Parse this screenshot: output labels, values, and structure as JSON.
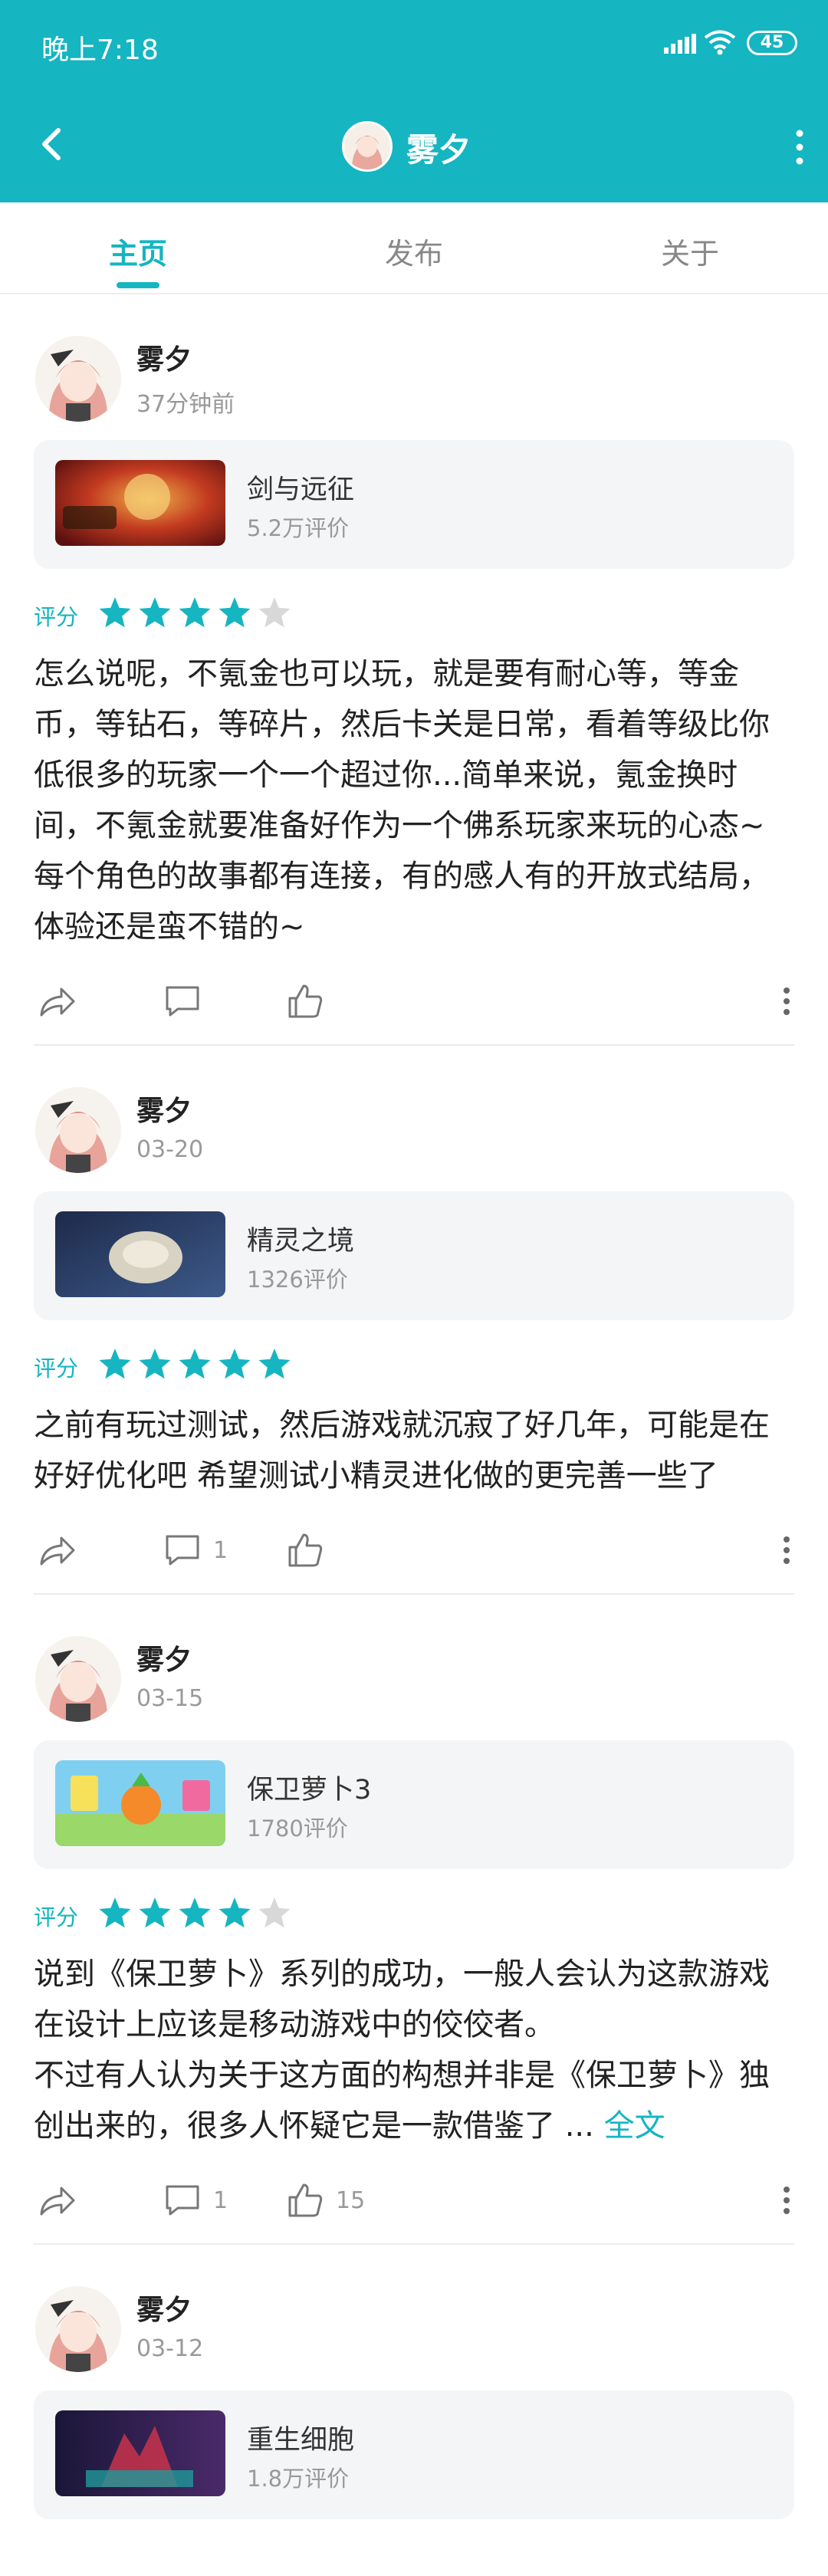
{
  "status_bar": {
    "time": "晚上7:18",
    "battery": "45"
  },
  "nav": {
    "title": "雾夕"
  },
  "tabs": [
    {
      "label": "主页"
    },
    {
      "label": "发布"
    },
    {
      "label": "关于"
    }
  ],
  "colors": {
    "accent": "#15b5c1",
    "star_off": "#d8d8d8"
  },
  "posts": [
    {
      "user": "雾夕",
      "time": "37分钟前",
      "game": {
        "name": "剑与远征",
        "reviews": "5.2万评价"
      },
      "rating_label": "评分",
      "stars": 4,
      "content": "怎么说呢，不氪金也可以玩，就是要有耐心等，等金币，等钻石，等碎片，然后卡关是日常，看着等级比你低很多的玩家一个一个超过你...简单来说，氪金换时间，不氪金就要准备好作为一个佛系玩家来玩的心态~每个角色的故事都有连接，有的感人有的开放式结局，体验还是蛮不错的~",
      "comments": "",
      "likes": ""
    },
    {
      "user": "雾夕",
      "time": "03-20",
      "game": {
        "name": "精灵之境",
        "reviews": "1326评价"
      },
      "rating_label": "评分",
      "stars": 5,
      "content": "之前有玩过测试，然后游戏就沉寂了好几年，可能是在好好优化吧 希望测试小精灵进化做的更完善一些了",
      "comments": "1",
      "likes": ""
    },
    {
      "user": "雾夕",
      "time": "03-15",
      "game": {
        "name": "保卫萝卜3",
        "reviews": "1780评价"
      },
      "rating_label": "评分",
      "stars": 4,
      "content": "说到《保卫萝卜》系列的成功，一般人会认为这款游戏在设计上应该是移动游戏中的佼佼者。\n不过有人认为关于这方面的构想并非是《保卫萝卜》独创出来的，很多人怀疑它是一款借鉴了 ... ",
      "more_link": "全文",
      "comments": "1",
      "likes": "15"
    },
    {
      "user": "雾夕",
      "time": "03-12",
      "game": {
        "name": "重生细胞",
        "reviews": "1.8万评价"
      }
    }
  ]
}
